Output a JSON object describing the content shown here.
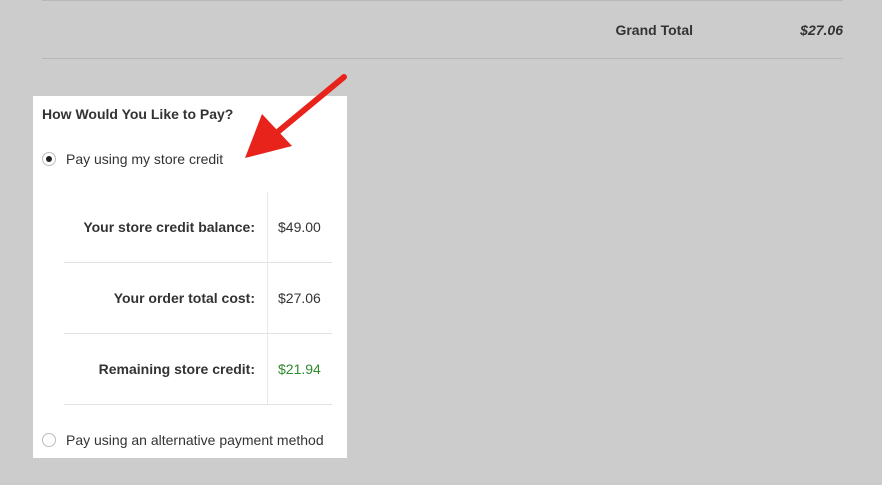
{
  "summary": {
    "grand_total_label": "Grand Total",
    "grand_total_value": "$27.06"
  },
  "payment": {
    "title": "How Would You Like to Pay?",
    "options": [
      {
        "label": "Pay using my store credit",
        "selected": true
      },
      {
        "label": "Pay using an alternative payment method",
        "selected": false
      }
    ],
    "credit_rows": [
      {
        "label": "Your store credit balance:",
        "value": "$49.00"
      },
      {
        "label": "Your order total cost:",
        "value": "$27.06"
      },
      {
        "label": "Remaining store credit:",
        "value": "$21.94"
      }
    ]
  },
  "colors": {
    "background": "#cccccc",
    "panel": "#ffffff",
    "remaining_credit": "#2e8b2e",
    "annotation_arrow": "#e8231c"
  },
  "icons": {
    "annotation": "red-arrow-icon"
  }
}
